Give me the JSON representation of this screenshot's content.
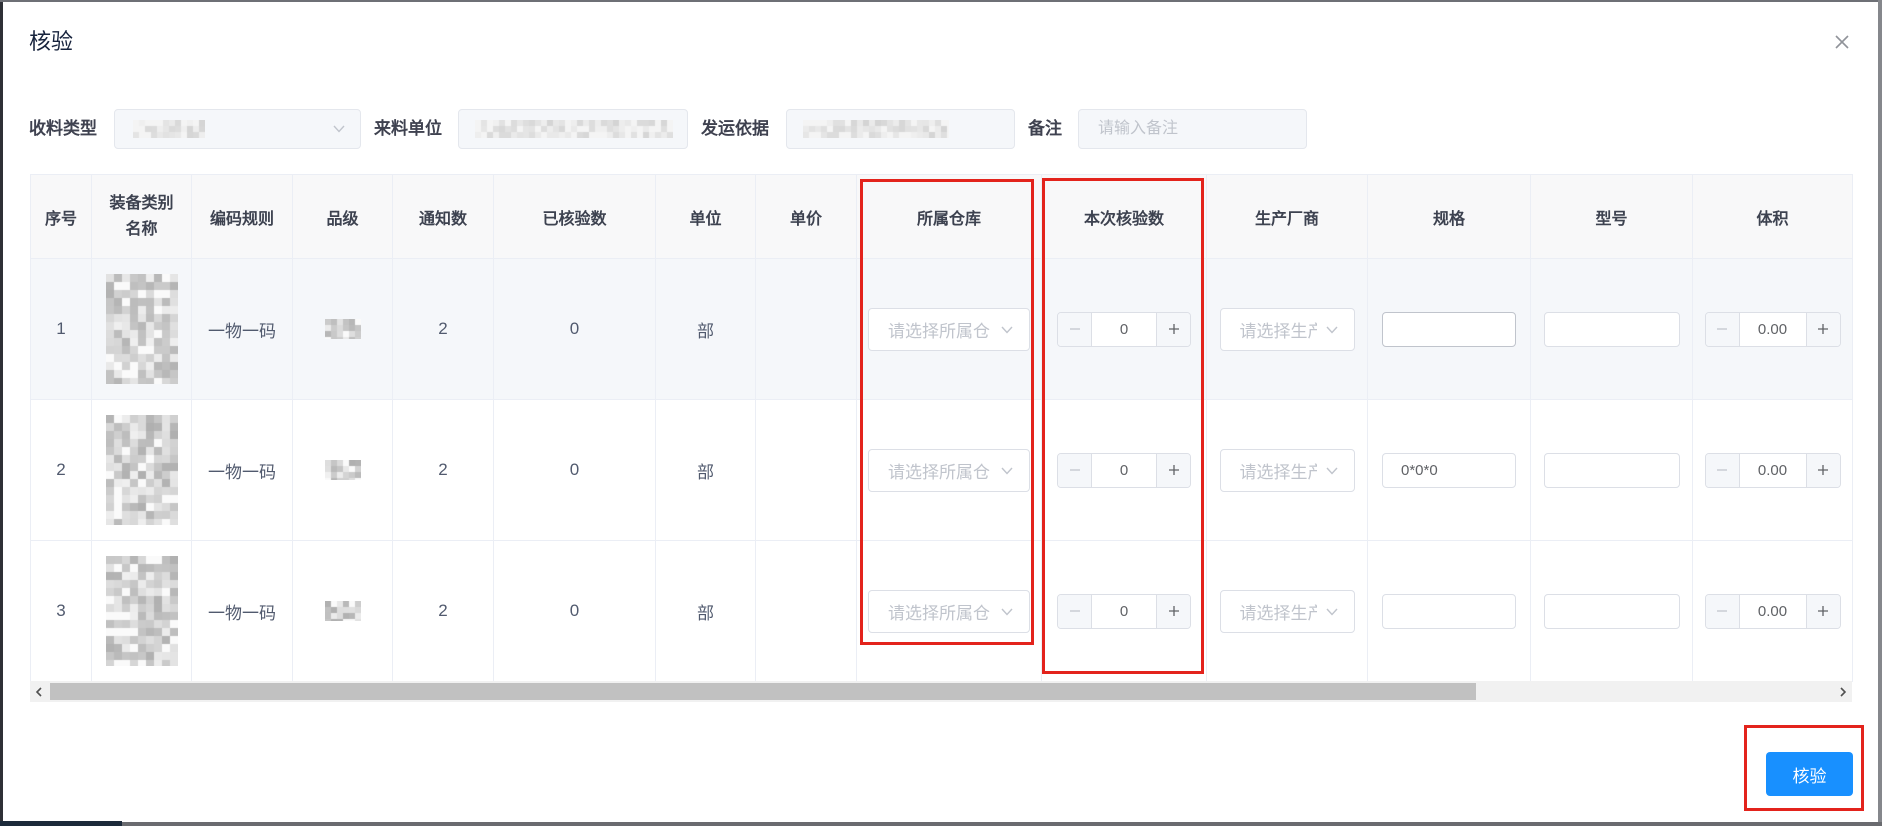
{
  "dialog": {
    "title": "核验"
  },
  "filters": {
    "receive_type": {
      "label": "收料类型"
    },
    "source_unit": {
      "label": "来料单位"
    },
    "shipping_basis": {
      "label": "发运依据"
    },
    "remark": {
      "label": "备注",
      "placeholder": "请输入备注",
      "value": ""
    }
  },
  "table": {
    "columns": [
      "序号",
      "装备类别名称",
      "编码规则",
      "品级",
      "通知数",
      "已核验数",
      "单位",
      "单价",
      "所属仓库",
      "本次核验数",
      "生产厂商",
      "规格",
      "型号",
      "体积"
    ],
    "rows": [
      {
        "index": "1",
        "code_rule": "一物一码",
        "notice_count": "2",
        "verified_count": "0",
        "unit": "部",
        "unit_price": "",
        "warehouse_placeholder": "请选择所属仓",
        "verify_qty": "0",
        "manufacturer_placeholder": "请选择生产",
        "spec": "",
        "model": "",
        "volume": "0.00"
      },
      {
        "index": "2",
        "code_rule": "一物一码",
        "notice_count": "2",
        "verified_count": "0",
        "unit": "部",
        "unit_price": "",
        "warehouse_placeholder": "请选择所属仓",
        "verify_qty": "0",
        "manufacturer_placeholder": "请选择生产",
        "spec": "0*0*0",
        "model": "",
        "volume": "0.00"
      },
      {
        "index": "3",
        "code_rule": "一物一码",
        "notice_count": "2",
        "verified_count": "0",
        "unit": "部",
        "unit_price": "",
        "warehouse_placeholder": "请选择所属仓",
        "verify_qty": "0",
        "manufacturer_placeholder": "请选择生产",
        "spec": "",
        "model": "",
        "volume": "0.00"
      }
    ]
  },
  "footer": {
    "submit_label": "核验"
  },
  "colors": {
    "primary": "#1890ff",
    "annotation_red": "#e3231c",
    "hover_row": "#f5f7fa",
    "placeholder": "#c0c4cc"
  },
  "icons": {
    "close": "close-icon",
    "dropdown": "chevron-down-icon",
    "decrease": "minus-icon",
    "increase": "plus-icon",
    "scroll_left": "chevron-left-icon",
    "scroll_right": "chevron-right-icon"
  }
}
